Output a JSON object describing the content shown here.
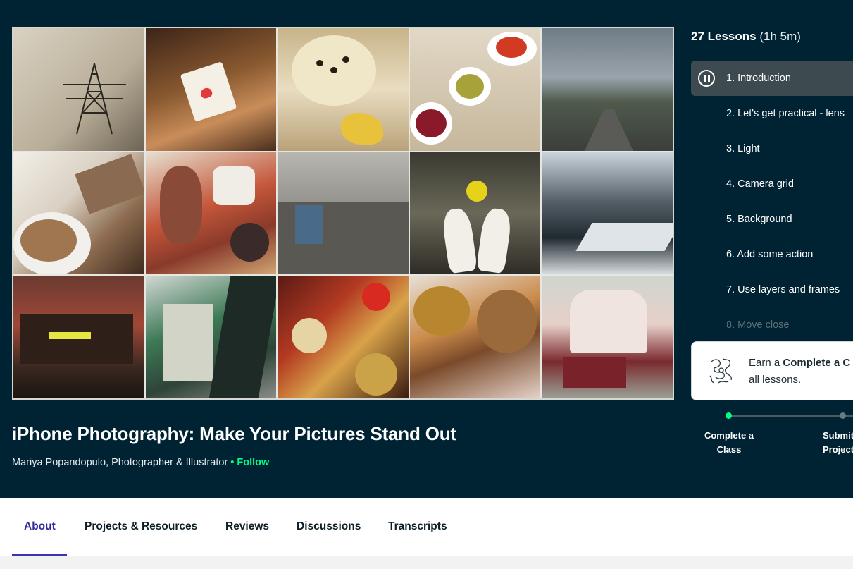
{
  "lessons_header": {
    "count": "27 Lessons",
    "duration": "(1h 5m)"
  },
  "lessons": [
    {
      "label": "1. Introduction"
    },
    {
      "label": "2. Let's get practical - lens"
    },
    {
      "label": "3. Light"
    },
    {
      "label": "4. Camera grid"
    },
    {
      "label": "5. Background"
    },
    {
      "label": "6. Add some action"
    },
    {
      "label": "7. Use layers and frames"
    },
    {
      "label": "8. Move close"
    }
  ],
  "earn_card": {
    "prefix": "Earn a ",
    "bold": "Complete a C",
    "line2": "all lessons."
  },
  "progress_steps": {
    "step1": "Complete a Class",
    "step2": "Submit Project"
  },
  "class": {
    "title": "iPhone Photography: Make Your Pictures Stand Out",
    "author": "Mariya Popandopulo, Photographer & Illustrator",
    "separator": "•",
    "follow": "Follow"
  },
  "tabs": [
    "About",
    "Projects & Resources",
    "Reviews",
    "Discussions",
    "Transcripts"
  ],
  "colors": {
    "background": "#002333",
    "accent_green": "#00ff84",
    "active_tab": "#2f2a9e"
  }
}
